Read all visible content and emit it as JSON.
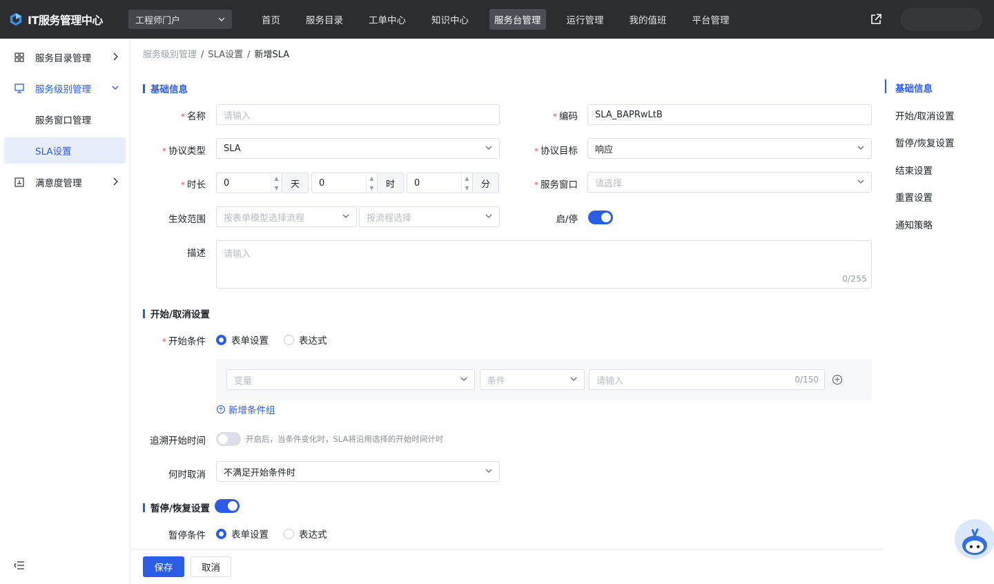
{
  "app": {
    "title": "IT服务管理中心",
    "portal": "工程师门户"
  },
  "nav": [
    {
      "label": "首页"
    },
    {
      "label": "服务目录"
    },
    {
      "label": "工单中心"
    },
    {
      "label": "知识中心"
    },
    {
      "label": "服务台管理",
      "active": true
    },
    {
      "label": "运行管理"
    },
    {
      "label": "我的值班"
    },
    {
      "label": "平台管理"
    }
  ],
  "sidebar": {
    "items": [
      {
        "label": "服务目录管理",
        "icon": "grid-icon"
      },
      {
        "label": "服务级别管理",
        "icon": "monitor-icon",
        "expanded": true
      },
      {
        "label": "服务窗口管理"
      },
      {
        "label": "SLA设置",
        "selected": true
      },
      {
        "label": "满意度管理",
        "icon": "chart-icon"
      }
    ]
  },
  "breadcrumb": {
    "l1": "服务级别管理",
    "l2": "SLA设置",
    "l3": "新增SLA"
  },
  "basic": {
    "title": "基础信息",
    "name_label": "名称",
    "name_placeholder": "请输入",
    "code_label": "编码",
    "code_value": "SLA_BAPRwLtB",
    "type_label": "协议类型",
    "type_value": "SLA",
    "target_label": "协议目标",
    "target_value": "响应",
    "duration_label": "时长",
    "days": "0",
    "day_unit": "天",
    "hours": "0",
    "hour_unit": "时",
    "minutes": "0",
    "minute_unit": "分",
    "window_label": "服务窗口",
    "window_placeholder": "请选择",
    "scope_label": "生效范围",
    "scope_placeholder1": "按表单模型选择流程",
    "scope_placeholder2": "按流程选择",
    "enable_label": "启/停",
    "enabled": true,
    "desc_label": "描述",
    "desc_placeholder": "请输入",
    "desc_count": "0/255"
  },
  "start": {
    "title": "开始/取消设置",
    "cond_label": "开始条件",
    "opt_form": "表单设置",
    "opt_expr": "表达式",
    "var_placeholder": "变量",
    "op_placeholder": "条件",
    "val_placeholder": "请输入",
    "val_count": "0/150",
    "add_group": "新增条件组",
    "trace_label": "追溯开始时间",
    "trace_hint": "开启后，当条件变化时，SLA将沿用选择的开始时间计时",
    "trace_enabled": false,
    "cancel_label": "何时取消",
    "cancel_value": "不满足开始条件时"
  },
  "pause": {
    "title": "暂停/恢复设置",
    "enabled": true,
    "cond_label": "暂停条件",
    "opt_form": "表单设置",
    "opt_expr": "表达式"
  },
  "buttons": {
    "save": "保存",
    "cancel": "取消"
  },
  "anchors": [
    {
      "label": "基础信息",
      "active": true
    },
    {
      "label": "开始/取消设置"
    },
    {
      "label": "暂停/恢复设置"
    },
    {
      "label": "结束设置"
    },
    {
      "label": "重置设置"
    },
    {
      "label": "通知策略"
    }
  ],
  "colors": {
    "primary": "#2b5ce6",
    "topbar": "#2b2d31"
  }
}
